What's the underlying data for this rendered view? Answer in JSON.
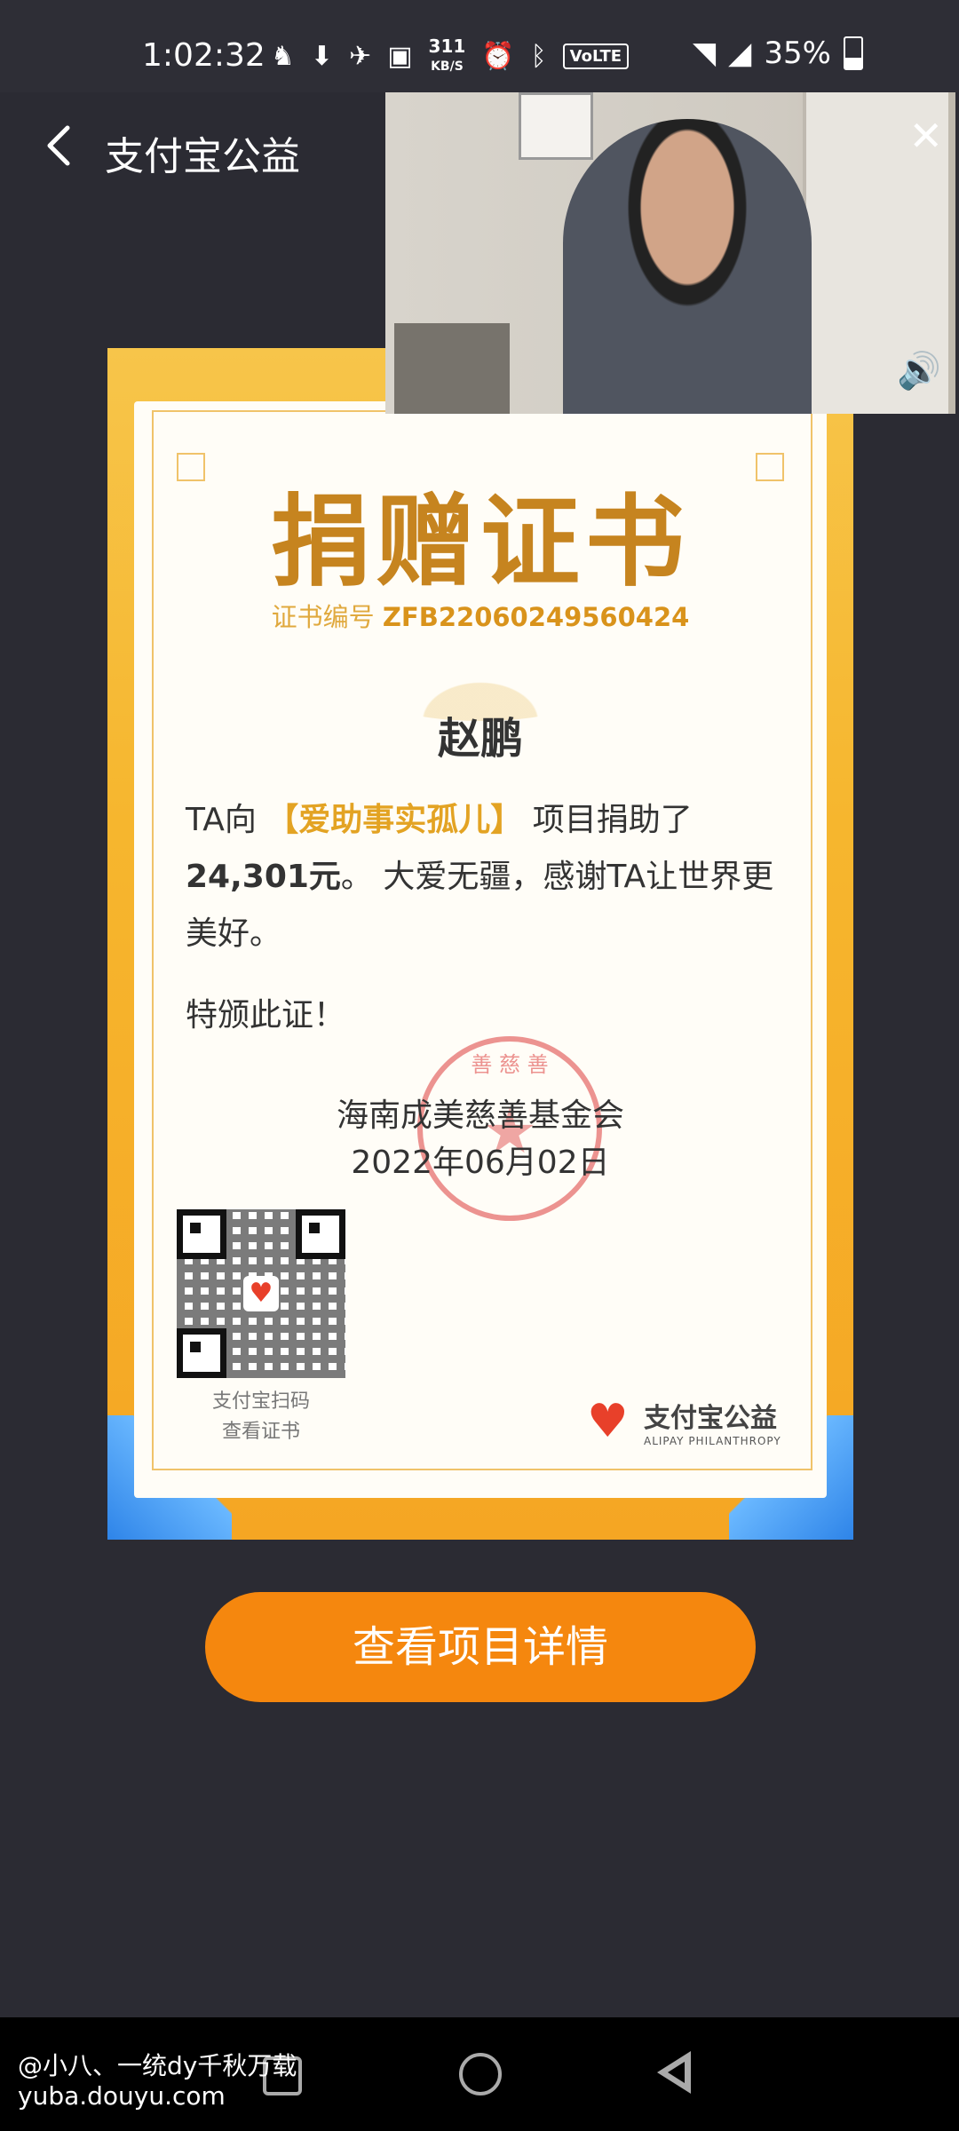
{
  "status_bar": {
    "time": "1:02:32",
    "network_speed_value": "311",
    "network_speed_unit": "KB/S",
    "volte": "VoLTE",
    "battery": "35%",
    "battery_level": 0.35
  },
  "app_bar": {
    "title": "支付宝公益"
  },
  "certificate": {
    "title": "捐赠证书",
    "number_label": "证书编号",
    "number_value": "ZFB22060249560424",
    "donor_name": "赵鹏",
    "text_prefix": "TA向",
    "project_name": "【爱助事实孤儿】",
    "text_mid": "项目捐助了",
    "amount": "24,301元",
    "text_suffix": "。 大爱无疆，感谢TA让世界更美好。",
    "closing": "特颁此证！",
    "organization": "海南成美慈善基金会",
    "date": "2022年06月02日",
    "qr_caption_line1": "支付宝扫码",
    "qr_caption_line2": "查看证书",
    "brand_name": "支付宝公益",
    "brand_subtitle": "ALIPAY PHILANTHROPY"
  },
  "actions": {
    "view_details": "查看项目详情"
  },
  "watermark": {
    "line1": "@小八、一统dy千秋万载",
    "line2": "yuba.douyu.com"
  },
  "colors": {
    "background": "#2b2b33",
    "button": "#f5870e",
    "cert_gold": "#c6841f",
    "project_highlight": "#e3a323"
  }
}
